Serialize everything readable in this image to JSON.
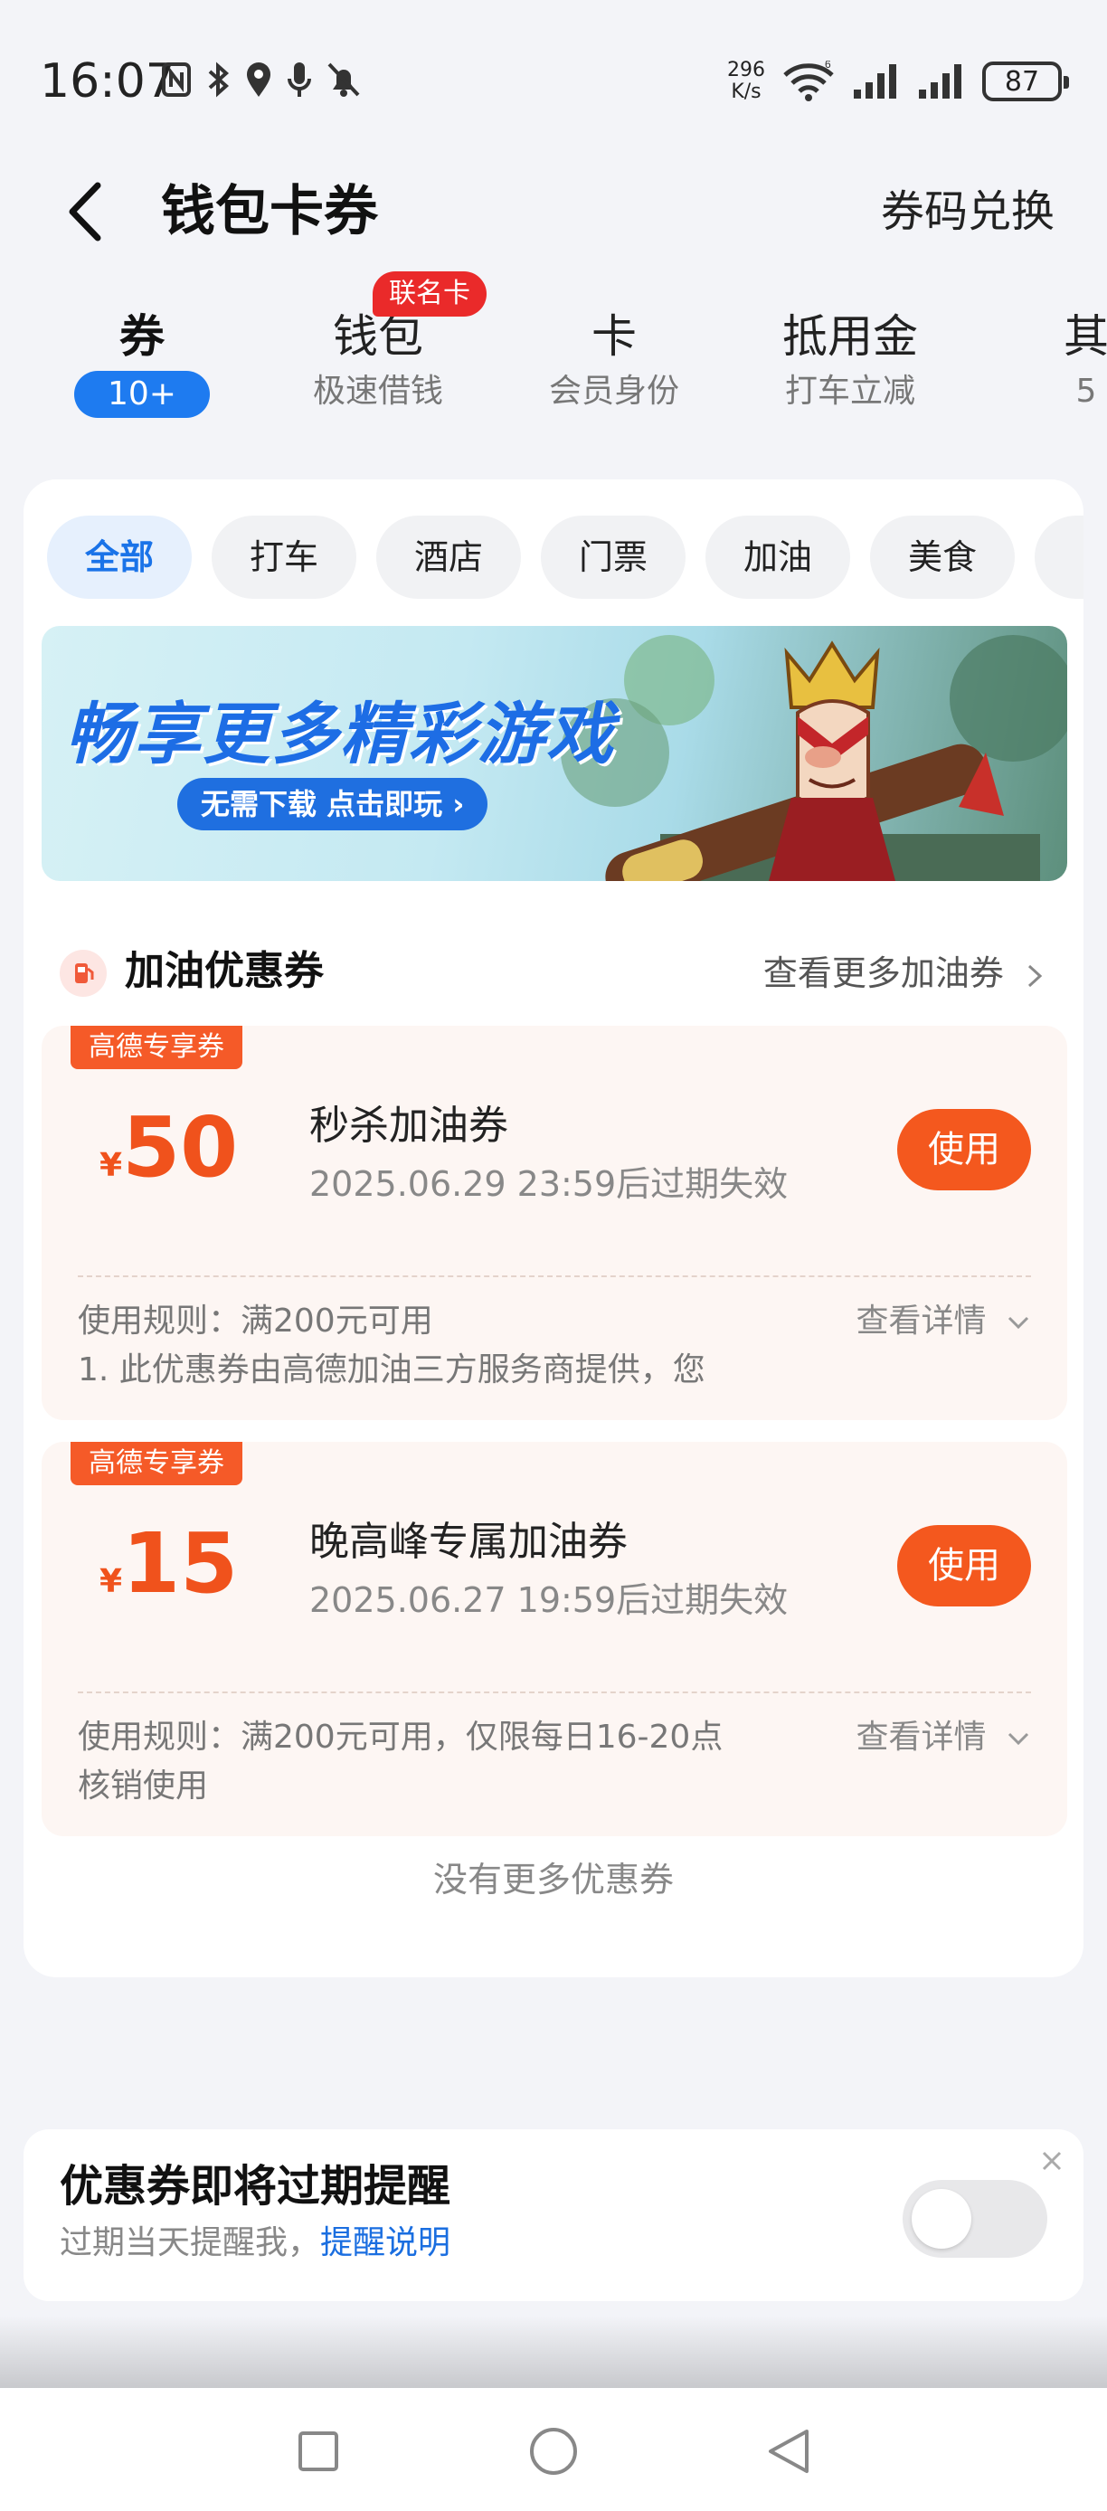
{
  "status_bar": {
    "time": "16:07",
    "net_speed_value": "296",
    "net_speed_unit": "K/s",
    "battery": "87",
    "icons": [
      "nfc-icon",
      "bluetooth-icon",
      "location-icon",
      "mic-icon",
      "mute-icon",
      "wifi-icon",
      "signal-icon",
      "signal-icon"
    ]
  },
  "header": {
    "title": "钱包卡券",
    "redeem": "券码兑换"
  },
  "top_tabs": [
    {
      "label": "券",
      "sub": "10+",
      "active": true
    },
    {
      "label": "钱包",
      "sub": "极速借钱",
      "badge": "联名卡"
    },
    {
      "label": "卡",
      "sub": "会员身份"
    },
    {
      "label": "抵用金",
      "sub": "打车立减"
    },
    {
      "label": "其",
      "sub": "5"
    }
  ],
  "chips": [
    "全部",
    "打车",
    "酒店",
    "门票",
    "加油",
    "美食"
  ],
  "banner": {
    "title": "畅享更多精彩游戏",
    "button": "无需下载 点击即玩 ›"
  },
  "section": {
    "title": "加油优惠券",
    "more": "查看更多加油券"
  },
  "coupons": [
    {
      "tag": "高德专享券",
      "currency": "¥",
      "amount": "50",
      "name": "秒杀加油券",
      "expire": "2025.06.29 23:59后过期失效",
      "use": "使用",
      "rule_line1": "使用规则：满200元可用",
      "rule_line2": "1. 此优惠券由高德加油三方服务商提供，您",
      "detail": "查看详情"
    },
    {
      "tag": "高德专享券",
      "currency": "¥",
      "amount": "15",
      "name": "晚高峰专属加油券",
      "expire": "2025.06.27 19:59后过期失效",
      "use": "使用",
      "rule_line1": "使用规则：满200元可用，仅限每日16-20点",
      "rule_line2": "核销使用",
      "detail": "查看详情"
    }
  ],
  "no_more": "没有更多优惠券",
  "reminder": {
    "title": "优惠券即将过期提醒",
    "sub": "过期当天提醒我，",
    "link": "提醒说明",
    "toggle_on": false
  },
  "colors": {
    "accent_blue": "#1e7bf0",
    "coupon_orange": "#f4581e",
    "badge_red": "#ea2a2a"
  }
}
